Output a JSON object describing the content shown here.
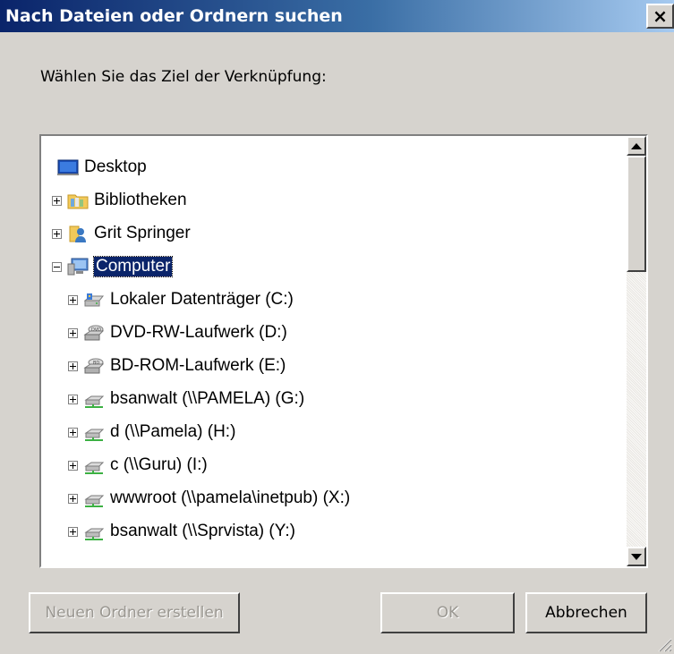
{
  "window": {
    "title": "Nach Dateien oder Ordnern suchen",
    "close_label": "×"
  },
  "prompt": "Wählen Sie das Ziel der Verknüpfung:",
  "tree": {
    "items": [
      {
        "label": "Desktop"
      },
      {
        "label": "Bibliotheken"
      },
      {
        "label": "Grit Springer"
      },
      {
        "label": "Computer"
      },
      {
        "label": "Lokaler Datenträger (C:)"
      },
      {
        "label": "DVD-RW-Laufwerk (D:)"
      },
      {
        "label": "BD-ROM-Laufwerk (E:)"
      },
      {
        "label": "bsanwalt (\\\\PAMELA) (G:)"
      },
      {
        "label": "d (\\\\Pamela) (H:)"
      },
      {
        "label": "c (\\\\Guru) (I:)"
      },
      {
        "label": "wwwroot (\\\\pamela\\inetpub) (X:)"
      },
      {
        "label": "bsanwalt (\\\\Sprvista) (Y:)"
      }
    ]
  },
  "buttons": {
    "new_folder": "Neuen Ordner erstellen",
    "ok": "OK",
    "cancel": "Abbrechen"
  }
}
